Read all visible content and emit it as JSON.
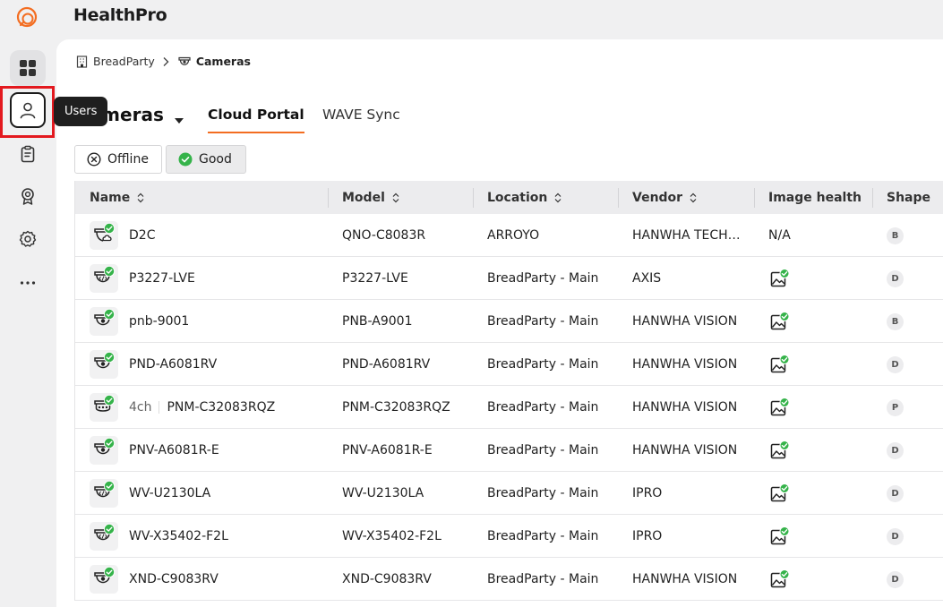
{
  "app": {
    "title": "HealthPro"
  },
  "colors": {
    "accent": "#f36d21",
    "success": "#35b34a",
    "highlight": "#e3191f"
  },
  "sidebar": {
    "items": [
      {
        "name": "dashboard",
        "icon": "grid-icon"
      },
      {
        "name": "users",
        "icon": "user-icon"
      },
      {
        "name": "reports",
        "icon": "clipboard-icon"
      },
      {
        "name": "badges",
        "icon": "award-icon"
      },
      {
        "name": "settings",
        "icon": "gear-icon"
      },
      {
        "name": "more",
        "icon": "more-dots-icon"
      }
    ],
    "tooltip": "Users"
  },
  "breadcrumb": {
    "root": "BreadParty",
    "current": "Cameras"
  },
  "page": {
    "title": "Cameras"
  },
  "tabs": [
    {
      "label": "Cloud Portal",
      "active": true
    },
    {
      "label": "WAVE Sync",
      "active": false
    }
  ],
  "filters": [
    {
      "label": "Offline",
      "icon": "x-circle-icon",
      "selected": false
    },
    {
      "label": "Good",
      "icon": "check-circle-icon",
      "selected": true
    }
  ],
  "table": {
    "columns": [
      "Name",
      "Model",
      "Location",
      "Vendor",
      "Image health",
      "Shape"
    ],
    "rows": [
      {
        "name": "D2C",
        "model": "QNO-C8083R",
        "location": "ARROYO",
        "vendor": "HANWHA TECH…",
        "image_health": "N/A",
        "shape": "B",
        "icon": "cloud-camera"
      },
      {
        "name": "P3227-LVE",
        "model": "P3227-LVE",
        "location": "BreadParty - Main",
        "vendor": "AXIS",
        "image_health": "",
        "shape": "D",
        "icon": "code-camera"
      },
      {
        "name": "pnb-9001",
        "model": "PNB-A9001",
        "location": "BreadParty - Main",
        "vendor": "HANWHA VISION",
        "image_health": "",
        "shape": "B",
        "icon": "camera"
      },
      {
        "name": "PND-A6081RV",
        "model": "PND-A6081RV",
        "location": "BreadParty - Main",
        "vendor": "HANWHA VISION",
        "image_health": "",
        "shape": "D",
        "icon": "camera"
      },
      {
        "name": "PNM-C32083RQZ",
        "channels": "4ch",
        "model": "PNM-C32083RQZ",
        "location": "BreadParty - Main",
        "vendor": "HANWHA VISION",
        "image_health": "",
        "shape": "P",
        "icon": "multi-camera"
      },
      {
        "name": "PNV-A6081R-E",
        "model": "PNV-A6081R-E",
        "location": "BreadParty - Main",
        "vendor": "HANWHA VISION",
        "image_health": "",
        "shape": "D",
        "icon": "camera"
      },
      {
        "name": "WV-U2130LA",
        "model": "WV-U2130LA",
        "location": "BreadParty - Main",
        "vendor": "IPRO",
        "image_health": "",
        "shape": "D",
        "icon": "code-camera"
      },
      {
        "name": "WV-X35402-F2L",
        "model": "WV-X35402-F2L",
        "location": "BreadParty - Main",
        "vendor": "IPRO",
        "image_health": "",
        "shape": "D",
        "icon": "code-camera"
      },
      {
        "name": "XND-C9083RV",
        "model": "XND-C9083RV",
        "location": "BreadParty - Main",
        "vendor": "HANWHA VISION",
        "image_health": "",
        "shape": "D",
        "icon": "camera"
      }
    ]
  }
}
